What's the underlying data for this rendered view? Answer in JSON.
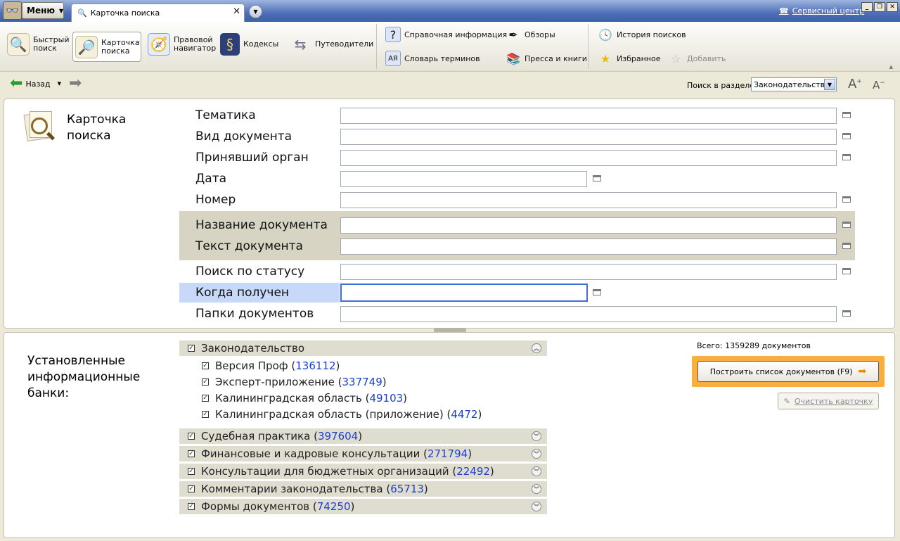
{
  "titlebar": {
    "menu_label": "Меню",
    "tab_title": "Карточка поиска",
    "service_center": "Сервисный центр"
  },
  "toolbar": {
    "quick_search": "Быстрый поиск",
    "search_card": "Карточка поиска",
    "legal_navigator": "Правовой навигатор",
    "codes": "Кодексы",
    "guides": "Путеводители",
    "reference_info": "Справочная информация",
    "glossary": "Словарь терминов",
    "reviews": "Обзоры",
    "press_books": "Пресса и книги",
    "search_history": "История поисков",
    "favorites": "Избранное",
    "add": "Добавить"
  },
  "nav": {
    "back_label": "Назад",
    "search_in_section_label": "Поиск в разделе",
    "section_value": "Законодательство"
  },
  "card": {
    "title": "Карточка поиска",
    "fields": {
      "topic": "Тематика",
      "doc_type": "Вид документа",
      "authority": "Принявший орган",
      "date": "Дата",
      "number": "Номер",
      "doc_name": "Название документа",
      "doc_text": "Текст документа",
      "status": "Поиск по статусу",
      "received": "Когда получен",
      "folders": "Папки документов"
    }
  },
  "banks": {
    "title": "Установленные информационные банки:",
    "total": "Всего: 1359289 документов",
    "build_button": "Построить список документов (F9)",
    "clear_button": "Очистить карточку",
    "legislation": "Законодательство",
    "sub": [
      {
        "name": "Версия Проф",
        "count": "136112"
      },
      {
        "name": "Эксперт-приложение",
        "count": "337749"
      },
      {
        "name": "Калининградская область",
        "count": "49103"
      },
      {
        "name": "Калининградская область (приложение)",
        "count": "4472"
      }
    ],
    "groups": [
      {
        "name": "Судебная практика",
        "count": "397604"
      },
      {
        "name": "Финансовые и кадровые консультации",
        "count": "271794"
      },
      {
        "name": "Консультации для бюджетных организаций",
        "count": "22492"
      },
      {
        "name": "Комментарии законодательства",
        "count": "65713"
      },
      {
        "name": "Формы документов",
        "count": "74250"
      }
    ]
  }
}
